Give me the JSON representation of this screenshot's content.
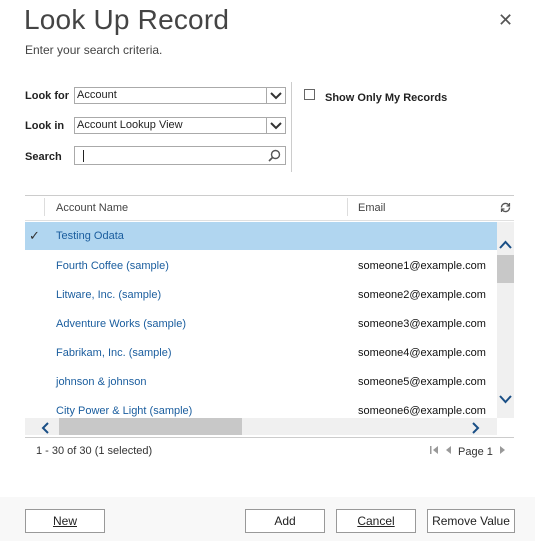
{
  "dialog": {
    "title": "Look Up Record",
    "subtitle": "Enter your search criteria.",
    "close_glyph": "✕"
  },
  "form": {
    "look_for_label": "Look for",
    "look_for_value": "Account",
    "look_in_label": "Look in",
    "look_in_value": "Account Lookup View",
    "search_label": "Search",
    "search_value": "",
    "show_only_mine_label": "Show Only My Records",
    "show_only_mine_checked": false
  },
  "grid": {
    "columns": [
      "Account Name",
      "Email"
    ],
    "rows": [
      {
        "name": "Testing Odata",
        "email": "",
        "selected": true
      },
      {
        "name": "Fourth Coffee (sample)",
        "email": "someone1@example.com",
        "selected": false
      },
      {
        "name": "Litware, Inc. (sample)",
        "email": "someone2@example.com",
        "selected": false
      },
      {
        "name": "Adventure Works (sample)",
        "email": "someone3@example.com",
        "selected": false
      },
      {
        "name": "Fabrikam, Inc. (sample)",
        "email": "someone4@example.com",
        "selected": false
      },
      {
        "name": "johnson & johnson",
        "email": "someone5@example.com",
        "selected": false
      },
      {
        "name": "City Power & Light (sample)",
        "email": "someone6@example.com",
        "selected": false
      }
    ],
    "status": "1 - 30 of 30 (1 selected)",
    "page_label": "Page 1"
  },
  "buttons": {
    "new": "New",
    "add": "Add",
    "cancel": "Cancel",
    "remove": "Remove Value"
  },
  "colors": {
    "selected_row": "#b1d6f0",
    "link_text": "#1a5d9e"
  }
}
